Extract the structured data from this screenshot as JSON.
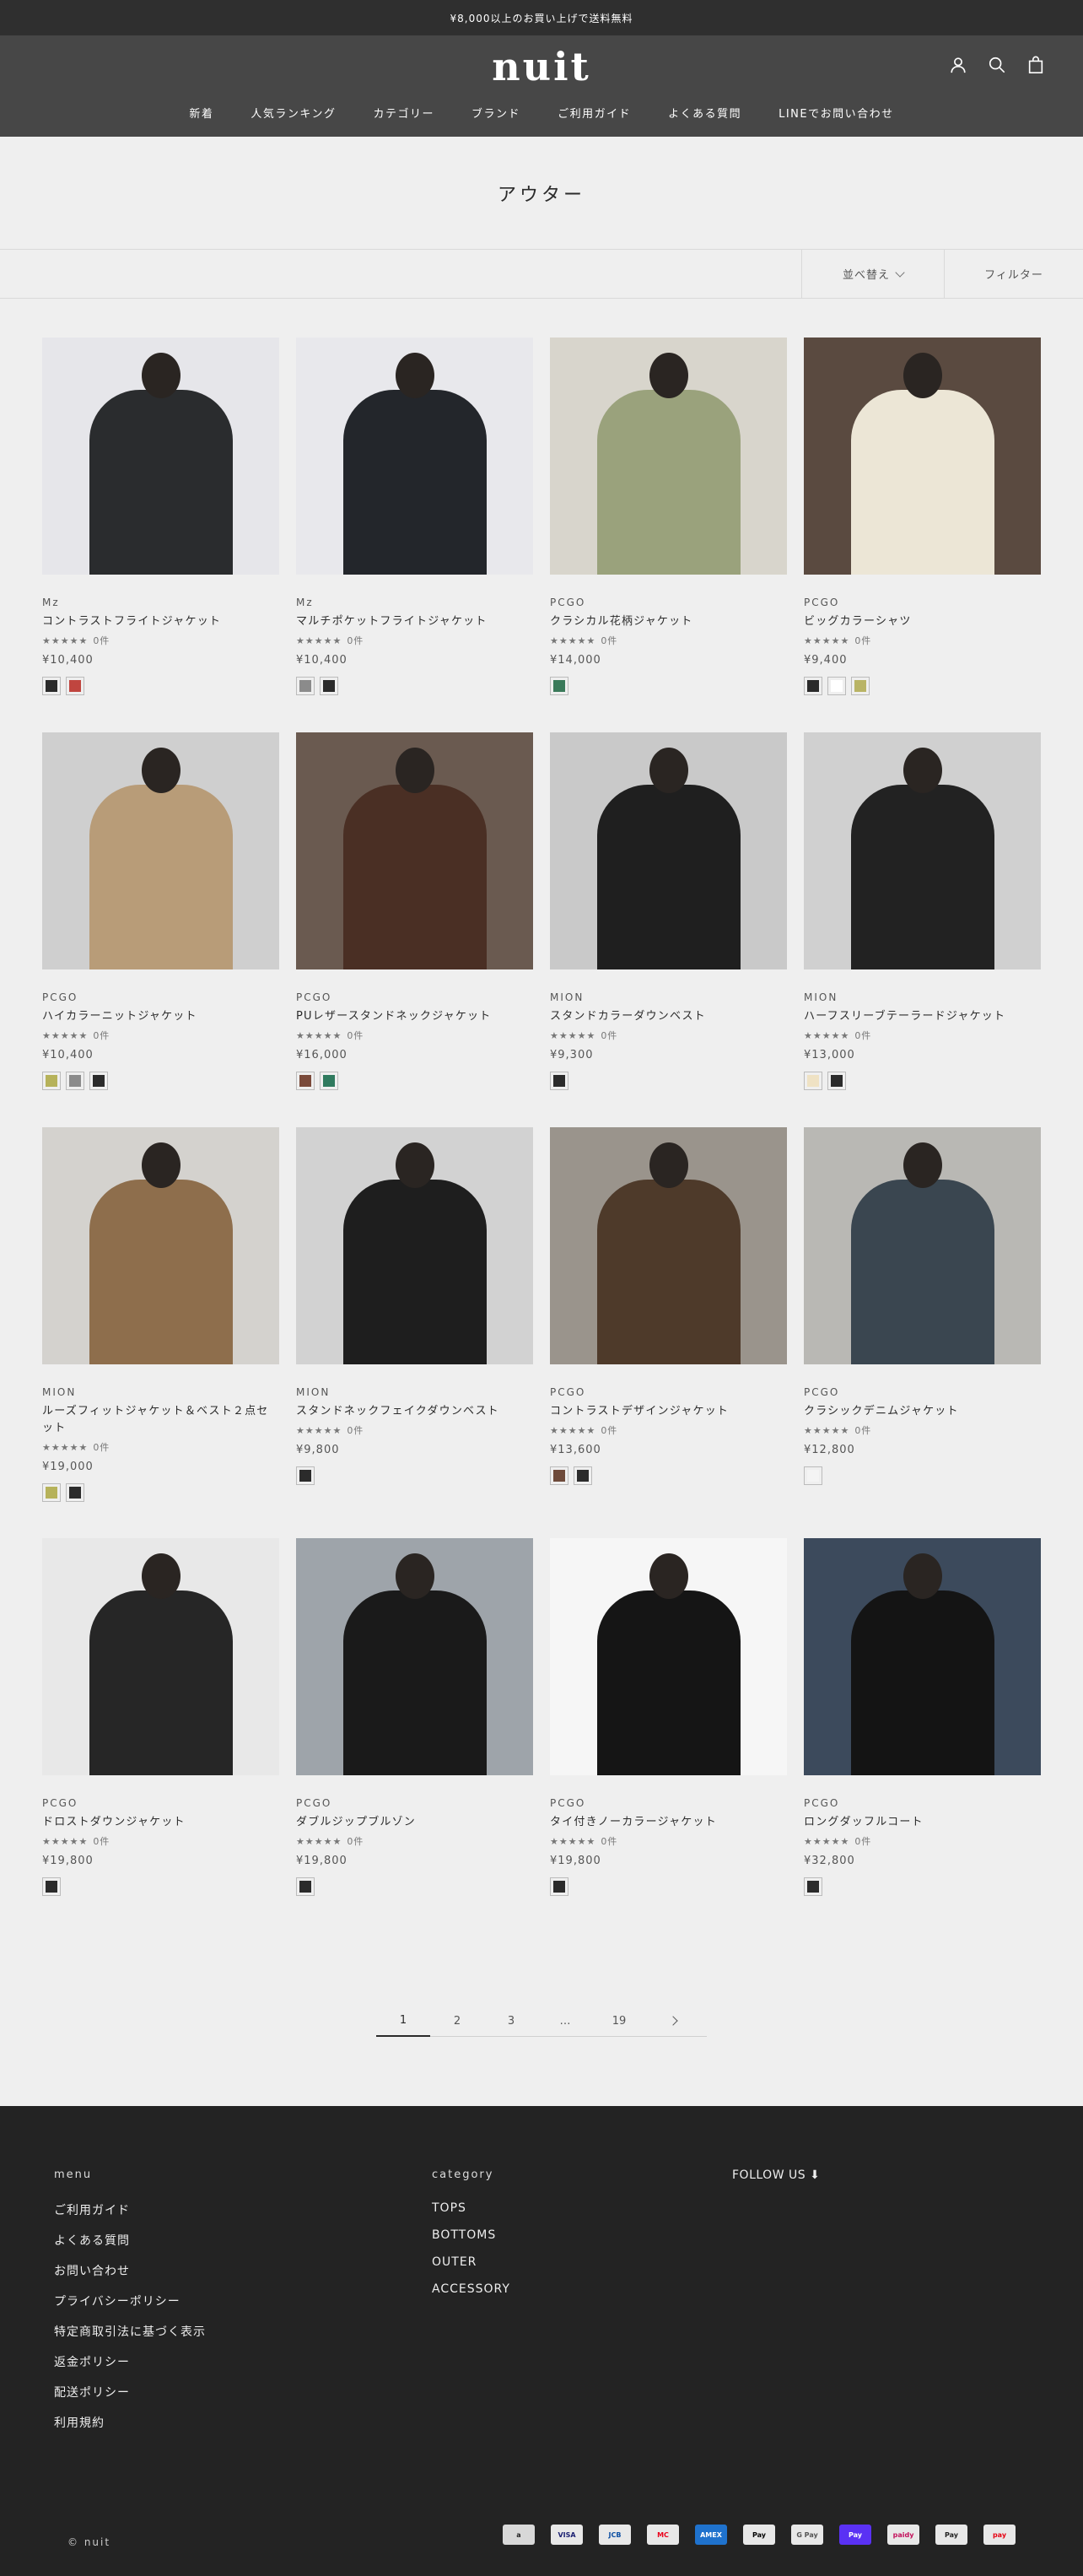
{
  "announcement": "¥8,000以上のお買い上げで送料無料",
  "header": {
    "logo": "nuit",
    "nav": [
      "新着",
      "人気ランキング",
      "カテゴリー",
      "ブランド",
      "ご利用ガイド",
      "よくある質問",
      "LINEでお問い合わせ"
    ]
  },
  "collection": {
    "title": "アウター"
  },
  "toolbar": {
    "sort_label": "並べ替え",
    "filter_label": "フィルター"
  },
  "products": [
    {
      "brand": "Mz",
      "name": "コントラストフライトジャケット",
      "stars": "★★★★★",
      "reviews": "0件",
      "price": "¥10,400",
      "bg": "#e6e6ea",
      "tone": "#2a2c2e",
      "swatches": [
        "#2b2b2b",
        "#c0453f"
      ]
    },
    {
      "brand": "Mz",
      "name": "マルチポケットフライトジャケット",
      "stars": "★★★★★",
      "reviews": "0件",
      "price": "¥10,400",
      "bg": "#e8e8ec",
      "tone": "#23262b",
      "swatches": [
        "#8b8b8b",
        "#2b2b2b"
      ]
    },
    {
      "brand": "PCGO",
      "name": "クラシカル花柄ジャケット",
      "stars": "★★★★★",
      "reviews": "0件",
      "price": "¥14,000",
      "bg": "#d8d5cc",
      "tone": "#9aa27c",
      "swatches": [
        "#3a7a5a"
      ]
    },
    {
      "brand": "PCGO",
      "name": "ビッグカラーシャツ",
      "stars": "★★★★★",
      "reviews": "0件",
      "price": "¥9,400",
      "bg": "#5a4a40",
      "tone": "#ece6d6",
      "swatches": [
        "#2b2b2b",
        "#ffffff",
        "#b9b465"
      ]
    },
    {
      "brand": "PCGO",
      "name": "ハイカラーニットジャケット",
      "stars": "★★★★★",
      "reviews": "0件",
      "price": "¥10,400",
      "bg": "#cfcfcf",
      "tone": "#b89c78",
      "swatches": [
        "#b6b25a",
        "#8b8b8b",
        "#2b2b2b"
      ]
    },
    {
      "brand": "PCGO",
      "name": "PUレザースタンドネックジャケット",
      "stars": "★★★★★",
      "reviews": "0件",
      "price": "¥16,000",
      "bg": "#6a5a50",
      "tone": "#4a2f24",
      "swatches": [
        "#7a4a3a",
        "#2f7a5e"
      ]
    },
    {
      "brand": "MION",
      "name": "スタンドカラーダウンベスト",
      "stars": "★★★★★",
      "reviews": "0件",
      "price": "¥9,300",
      "bg": "#c9c9c9",
      "tone": "#1f1f1f",
      "swatches": [
        "#2b2b2b"
      ]
    },
    {
      "brand": "MION",
      "name": "ハーフスリーブテーラードジャケット",
      "stars": "★★★★★",
      "reviews": "0件",
      "price": "¥13,000",
      "bg": "#d0d0d0",
      "tone": "#222222",
      "swatches": [
        "#efe2c4",
        "#2b2b2b"
      ]
    },
    {
      "brand": "MION",
      "name": "ルーズフィットジャケット＆ベスト２点セット",
      "stars": "★★★★★",
      "reviews": "0件",
      "price": "¥19,000",
      "bg": "#d4d2ce",
      "tone": "#8e6e4c",
      "swatches": [
        "#b6b25a",
        "#2b2b2b"
      ]
    },
    {
      "brand": "MION",
      "name": "スタンドネックフェイクダウンベスト",
      "stars": "★★★★★",
      "reviews": "0件",
      "price": "¥9,800",
      "bg": "#d2d2d2",
      "tone": "#1e1e1e",
      "swatches": [
        "#2b2b2b"
      ]
    },
    {
      "brand": "PCGO",
      "name": "コントラストデザインジャケット",
      "stars": "★★★★★",
      "reviews": "0件",
      "price": "¥13,600",
      "bg": "#9a948c",
      "tone": "#4e3a2a",
      "swatches": [
        "#6e4a3a",
        "#2b2b2b"
      ]
    },
    {
      "brand": "PCGO",
      "name": "クラシックデニムジャケット",
      "stars": "★★★★★",
      "reviews": "0件",
      "price": "¥12,800",
      "bg": "#b9b8b4",
      "tone": "#3a4650",
      "swatches": [
        "#f4f4f4"
      ]
    },
    {
      "brand": "PCGO",
      "name": "ドロストダウンジャケット",
      "stars": "★★★★★",
      "reviews": "0件",
      "price": "¥19,800",
      "bg": "#e8e8e8",
      "tone": "#262626",
      "swatches": [
        "#2b2b2b"
      ]
    },
    {
      "brand": "PCGO",
      "name": "ダブルジップブルゾン",
      "stars": "★★★★★",
      "reviews": "0件",
      "price": "¥19,800",
      "bg": "#9ea4aa",
      "tone": "#1a1a1a",
      "swatches": [
        "#2b2b2b"
      ]
    },
    {
      "brand": "PCGO",
      "name": "タイ付きノーカラージャケット",
      "stars": "★★★★★",
      "reviews": "0件",
      "price": "¥19,800",
      "bg": "#f6f6f6",
      "tone": "#151515",
      "swatches": [
        "#2b2b2b"
      ]
    },
    {
      "brand": "PCGO",
      "name": "ロングダッフルコート",
      "stars": "★★★★★",
      "reviews": "0件",
      "price": "¥32,800",
      "bg": "#3c4a5c",
      "tone": "#141414",
      "swatches": [
        "#2b2b2b"
      ]
    }
  ],
  "pagination": [
    "1",
    "2",
    "3",
    "…",
    "19"
  ],
  "footer": {
    "menu_title": "menu",
    "menu": [
      "ご利用ガイド",
      "よくある質問",
      "お問い合わせ",
      "プライバシーポリシー",
      "特定商取引法に基づく表示",
      "返金ポリシー",
      "配送ポリシー",
      "利用規約"
    ],
    "category_title": "category",
    "category": [
      "TOPS",
      "BOTTOMS",
      "OUTER",
      "ACCESSORY"
    ],
    "follow": "FOLLOW US ⬇",
    "copyright": "© nuit",
    "payments": [
      {
        "label": "a",
        "color": "#d8d8d8",
        "text": "#222"
      },
      {
        "label": "VISA",
        "color": "#e8e8e8",
        "text": "#1a1f71"
      },
      {
        "label": "JCB",
        "color": "#e8e8e8",
        "text": "#0b4ea2"
      },
      {
        "label": "MC",
        "color": "#e8e8e8",
        "text": "#eb001b"
      },
      {
        "label": "AMEX",
        "color": "#1f72cd",
        "text": "#fff"
      },
      {
        "label": "Pay",
        "color": "#e8e8e8",
        "text": "#000"
      },
      {
        "label": "G Pay",
        "color": "#e8e8e8",
        "text": "#555"
      },
      {
        "label": "Pay",
        "color": "#5a31f4",
        "text": "#fff"
      },
      {
        "label": "paidy",
        "color": "#e8e8e8",
        "text": "#c3105b"
      },
      {
        "label": "Pay",
        "color": "#e8e8e8",
        "text": "#222"
      },
      {
        "label": "pay",
        "color": "#e8e8e8",
        "text": "#e60012"
      }
    ]
  }
}
